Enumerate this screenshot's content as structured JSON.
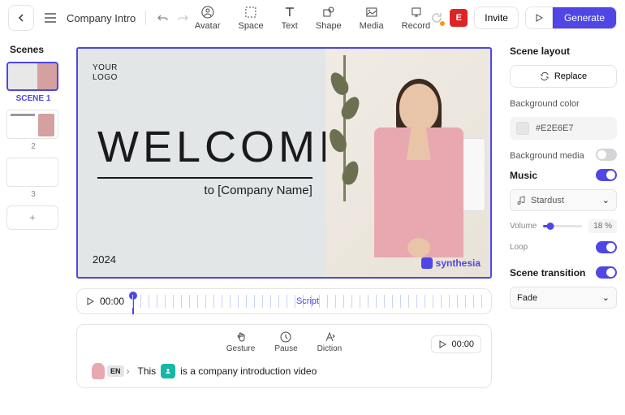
{
  "header": {
    "title": "Company Intro",
    "tools": [
      {
        "label": "Avatar"
      },
      {
        "label": "Space"
      },
      {
        "label": "Text"
      },
      {
        "label": "Shape"
      },
      {
        "label": "Media"
      },
      {
        "label": "Record"
      }
    ],
    "user_initial": "E",
    "invite": "Invite",
    "generate": "Generate"
  },
  "sidebar": {
    "title": "Scenes",
    "scenes": [
      {
        "label": "SCENE 1"
      },
      {
        "label": "2"
      },
      {
        "label": "3"
      }
    ]
  },
  "canvas": {
    "logo_line1": "YOUR",
    "logo_line2": "LOGO",
    "welcome": "WELCOME",
    "subtitle": "to [Company Name]",
    "year": "2024",
    "watermark": "synthesia"
  },
  "timeline": {
    "time": "00:00",
    "label": "Script"
  },
  "script": {
    "tools": [
      {
        "label": "Gesture"
      },
      {
        "label": "Pause"
      },
      {
        "label": "Diction"
      }
    ],
    "time": "00:00",
    "lang": "EN",
    "text_before": "This",
    "text_after": "is a company introduction video"
  },
  "right_panel": {
    "layout_title": "Scene layout",
    "replace": "Replace",
    "bg_color_label": "Background color",
    "bg_color_value": "#E2E6E7",
    "bg_media_label": "Background media",
    "music_label": "Music",
    "music_track": "Stardust",
    "volume_label": "Volume",
    "volume_value": "18",
    "volume_pct": "%",
    "loop_label": "Loop",
    "transition_label": "Scene transition",
    "transition_value": "Fade"
  }
}
